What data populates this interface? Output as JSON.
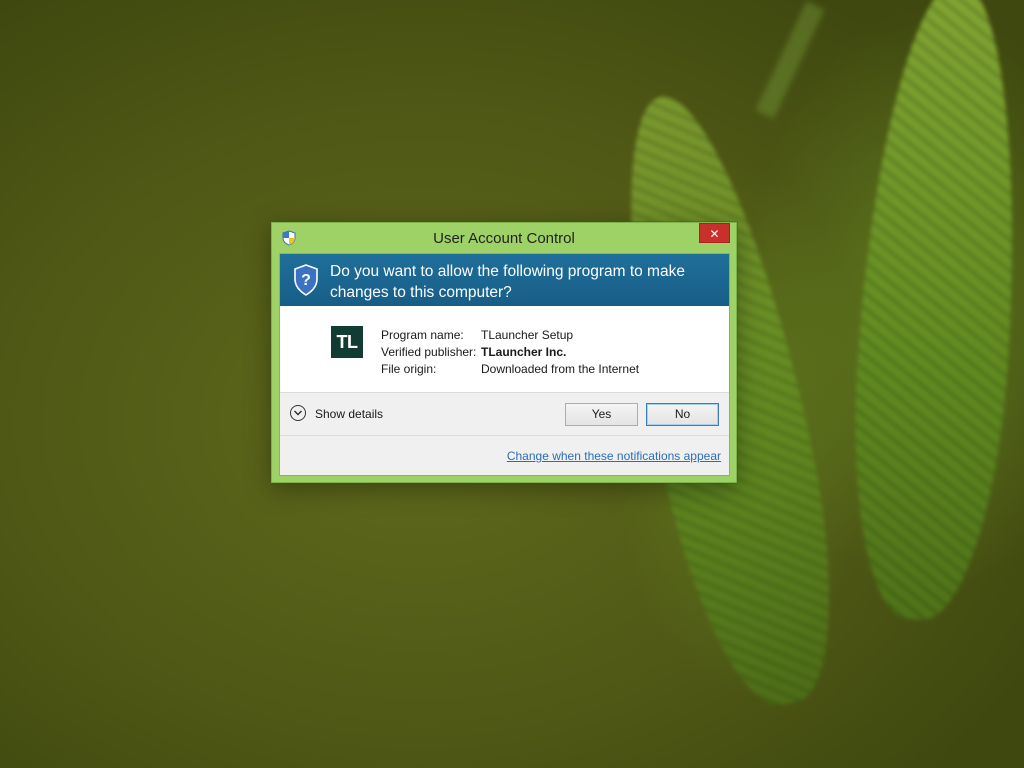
{
  "window": {
    "title": "User Account Control",
    "close_glyph": "✕"
  },
  "header": {
    "question": "Do you want to allow the following program to make changes to this computer?"
  },
  "program": {
    "icon_text": "TL",
    "rows": [
      {
        "label": "Program name:",
        "value": "TLauncher Setup"
      },
      {
        "label": "Verified publisher:",
        "value": "TLauncher Inc."
      },
      {
        "label": "File origin:",
        "value": "Downloaded from the Internet"
      }
    ]
  },
  "details": {
    "show_details_label": "Show details",
    "yes_label": "Yes",
    "no_label": "No"
  },
  "footer": {
    "link_text": "Change when these notifications appear"
  },
  "colors": {
    "header_blue": "#1f6f9a",
    "window_frame": "#9fd266",
    "close_red": "#c7302b",
    "link_blue": "#2a6eb8"
  },
  "icons": {
    "title": "uac-shield-icon",
    "header": "uac-shield-icon",
    "expand": "chevron-down-icon",
    "close": "close-icon"
  }
}
